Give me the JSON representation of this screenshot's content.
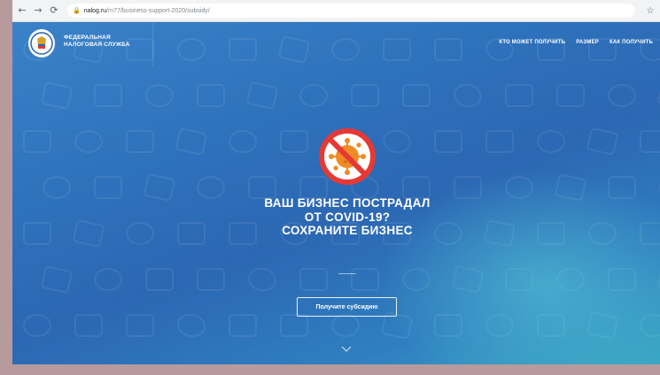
{
  "browser": {
    "url_host": "nalog.ru",
    "url_path": "/rn77/business-support-2020/subsidy/",
    "back_icon": "arrow-left",
    "forward_icon": "arrow-right",
    "reload_icon": "reload",
    "lock_icon": "lock",
    "bookmark_icon": "star"
  },
  "header": {
    "logo_icon": "fns-emblem",
    "brand_line1": "ФЕДЕРАЛЬНАЯ",
    "brand_line2": "НАЛОГОВАЯ СЛУЖБА",
    "nav": [
      "КТО МОЖЕТ ПОЛУЧИТЬ",
      "РАЗМЕР",
      "КАК ПОЛУЧИТЬ"
    ]
  },
  "hero": {
    "badge_icon": "no-virus",
    "headline_lines": [
      "ВАШ БИЗНЕС ПОСТРАДАЛ",
      "ОТ COVID-19?",
      "СОХРАНИТЕ БИЗНЕС"
    ],
    "cta_label": "Получите субсидию",
    "scroll_icon": "chevron-down",
    "colors": {
      "gradient_top": "#3a82c8",
      "gradient_bottom": "#3aa7c4",
      "badge_red": "#e53935",
      "badge_orange": "#f08a24"
    }
  }
}
